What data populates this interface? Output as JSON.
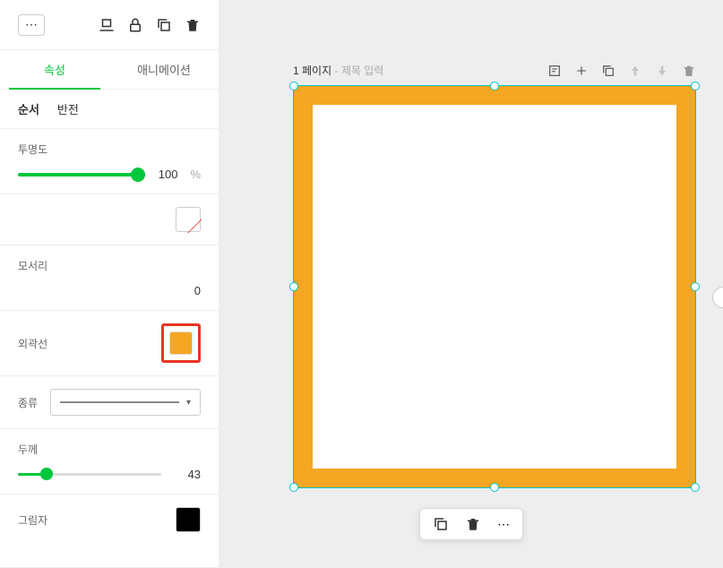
{
  "sidebar": {
    "tabs": {
      "attributes": "속성",
      "animation": "애니메이션"
    },
    "subtabs": {
      "order": "순서",
      "flip": "반전"
    },
    "opacity": {
      "label": "투명도",
      "value": "100",
      "unit": "%"
    },
    "corner": {
      "label": "모서리",
      "value": "0"
    },
    "outline": {
      "label": "외곽선"
    },
    "type": {
      "label": "종류"
    },
    "thickness": {
      "label": "두께",
      "value": "43"
    },
    "shadow": {
      "label": "그림자"
    },
    "colors": {
      "outline": "#f5a623",
      "shadow": "#000000"
    }
  },
  "canvas": {
    "page_num": "1 페이지",
    "title_placeholder": "제목 입력",
    "shape": {
      "fill": "#ffffff",
      "border": "#f5a623",
      "border_width": 22
    }
  }
}
